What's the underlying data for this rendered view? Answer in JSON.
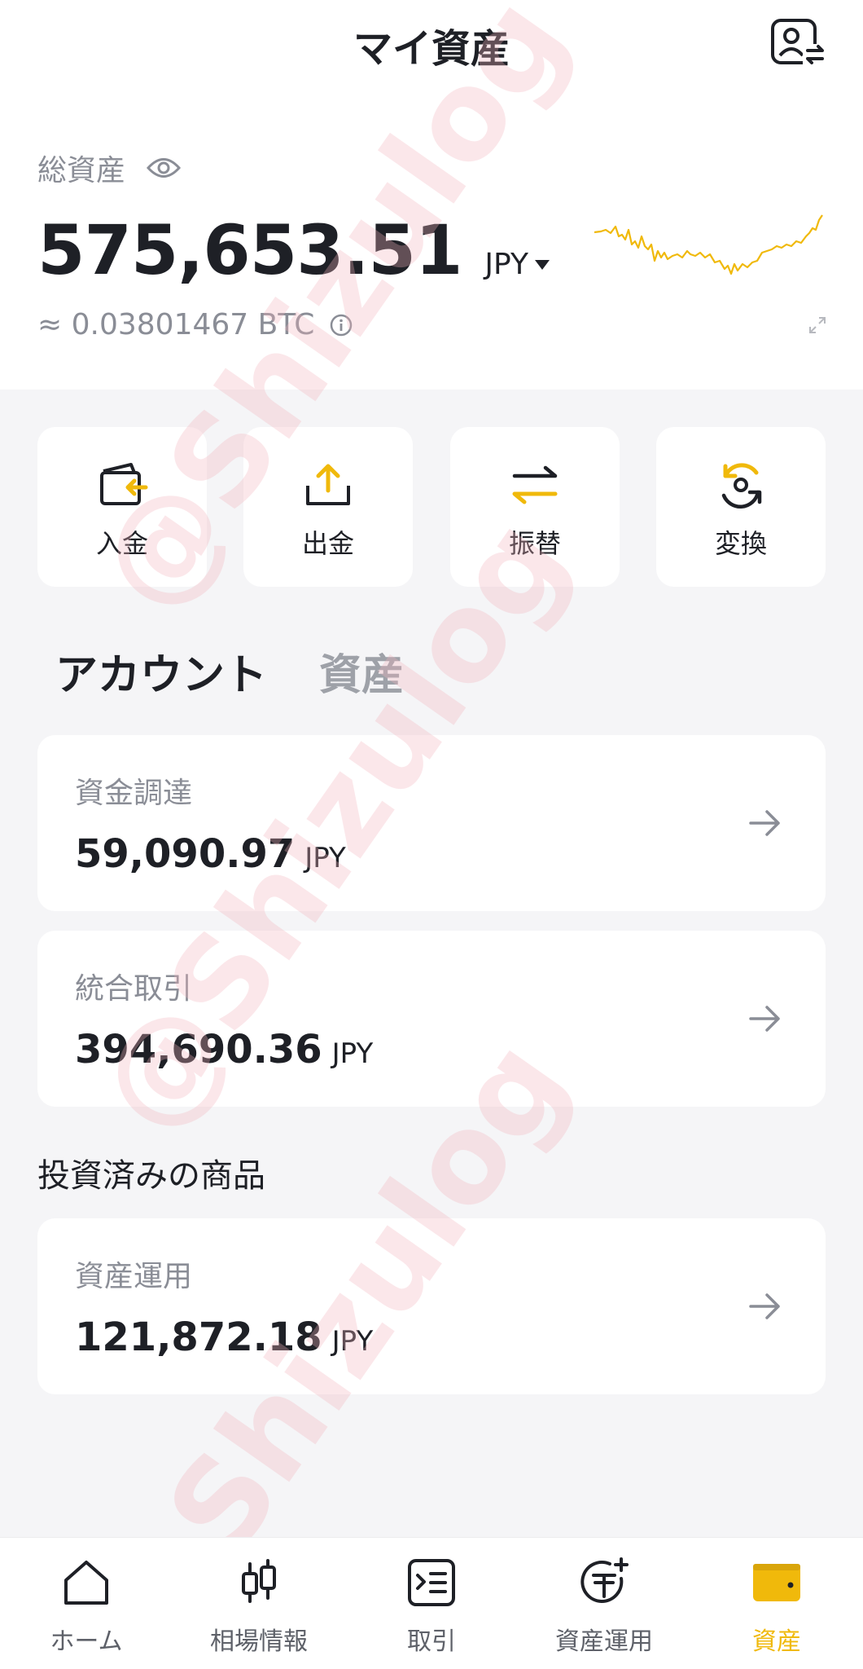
{
  "header": {
    "title": "マイ資産"
  },
  "summary": {
    "total_label": "総資産",
    "total_amount": "575,653.51",
    "currency": "JPY",
    "btc_equivalent": "≈ 0.03801467 BTC"
  },
  "actions": [
    {
      "label": "入金",
      "icon": "deposit-wallet-icon"
    },
    {
      "label": "出金",
      "icon": "withdraw-upload-icon"
    },
    {
      "label": "振替",
      "icon": "transfer-arrows-icon"
    },
    {
      "label": "変換",
      "icon": "convert-cycle-icon"
    }
  ],
  "tabs": [
    {
      "label": "アカウント",
      "active": true
    },
    {
      "label": "資産",
      "active": false
    }
  ],
  "accounts": [
    {
      "label": "資金調達",
      "value": "59,090.97",
      "unit": "JPY"
    },
    {
      "label": "統合取引",
      "value": "394,690.36",
      "unit": "JPY"
    }
  ],
  "invested": {
    "section_title": "投資済みの商品",
    "items": [
      {
        "label": "資産運用",
        "value": "121,872.18",
        "unit": "JPY"
      }
    ]
  },
  "bottom_nav": [
    {
      "label": "ホーム",
      "icon": "home-icon",
      "active": false
    },
    {
      "label": "相場情報",
      "icon": "candlestick-icon",
      "active": false
    },
    {
      "label": "取引",
      "icon": "trade-icon",
      "active": false
    },
    {
      "label": "資産運用",
      "icon": "earn-icon",
      "active": false
    },
    {
      "label": "資産",
      "icon": "wallet-icon",
      "active": true
    }
  ],
  "colors": {
    "accent": "#f0b90b",
    "text_primary": "#1e2026",
    "text_secondary": "#8a8d96",
    "background": "#f5f5f7"
  },
  "watermark": "@Shizulog"
}
